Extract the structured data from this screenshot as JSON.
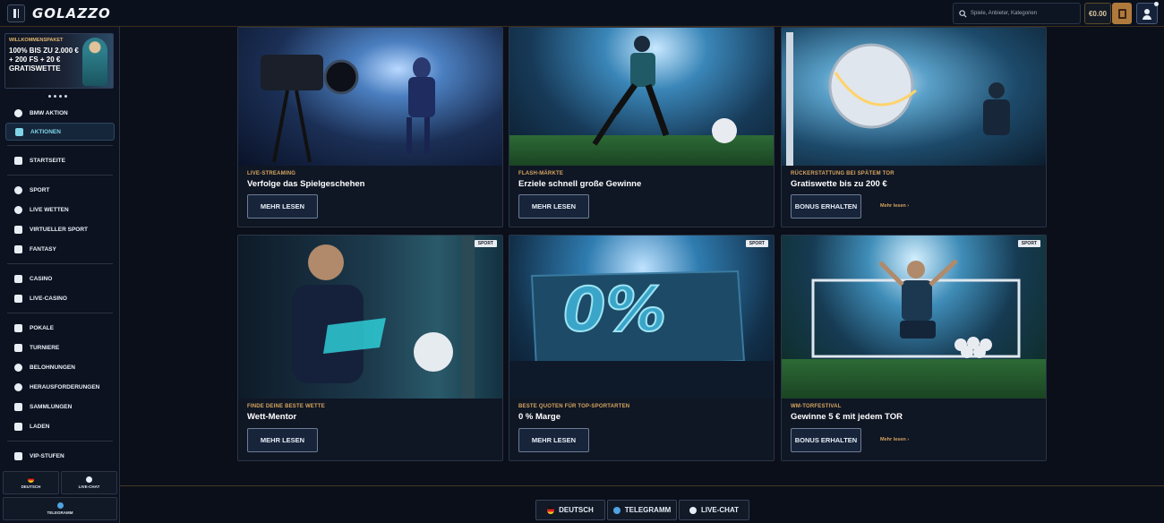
{
  "app": {
    "logo": "GOLAZZO"
  },
  "header": {
    "search_placeholder": "Spiele, Anbieter, Kategorien",
    "balance": "€0.00"
  },
  "sidebar": {
    "promo": {
      "kicker": "WILLKOMMENSPAKET",
      "text": "100% BIS ZU 2.000 € + 200 FS + 20 € GRATISWETTE"
    },
    "groups": [
      [
        {
          "label": "BMW AKTION",
          "icon": "soccer-ball-icon"
        },
        {
          "label": "AKTIONEN",
          "icon": "gift-icon",
          "active": true
        }
      ],
      [
        {
          "label": "STARTSEITE",
          "icon": "gamepad-icon"
        }
      ],
      [
        {
          "label": "SPORT",
          "icon": "soccer-ball-icon"
        },
        {
          "label": "LIVE WETTEN",
          "icon": "live-icon"
        },
        {
          "label": "VIRTUELLER SPORT",
          "icon": "virtual-icon"
        },
        {
          "label": "FANTASY",
          "icon": "shirt-icon"
        }
      ],
      [
        {
          "label": "CASINO",
          "icon": "cards-icon"
        },
        {
          "label": "LIVE-CASINO",
          "icon": "live-casino-icon"
        }
      ],
      [
        {
          "label": "POKALE",
          "icon": "trophy-icon"
        },
        {
          "label": "TURNIERE",
          "icon": "podium-icon"
        },
        {
          "label": "BELOHNUNGEN",
          "icon": "reward-icon"
        },
        {
          "label": "HERAUSFORDERUNGEN",
          "icon": "target-icon"
        },
        {
          "label": "SAMMLUNGEN",
          "icon": "collection-icon"
        },
        {
          "label": "LADEN",
          "icon": "shop-icon"
        }
      ],
      [
        {
          "label": "VIP-STUFEN",
          "icon": "vip-icon"
        }
      ]
    ],
    "buttons": {
      "language": "DEUTSCH",
      "chat": "LIVE-CHAT",
      "telegram": "TELEGRAMM"
    }
  },
  "cards": [
    {
      "kicker": "LIVE-STREAMING",
      "title": "Verfolge das Spielgeschehen",
      "button": "MEHR LESEN"
    },
    {
      "kicker": "FLASH-MÄRKTE",
      "title": "Erziele schnell große Gewinne",
      "button": "MEHR LESEN"
    },
    {
      "kicker": "RÜCKERSTATTUNG BEI SPÄTEM TOR",
      "title": "Gratiswette bis zu 200 €",
      "button": "BONUS ERHALTEN",
      "more": "Mehr lesen ›"
    },
    {
      "kicker": "FINDE DEINE BESTE WETTE",
      "title": "Wett-Mentor",
      "button": "MEHR LESEN",
      "badge": "SPORT"
    },
    {
      "kicker": "BESTE QUOTEN FÜR TOP-SPORTARTEN",
      "title": "0 % Marge",
      "button": "MEHR LESEN",
      "badge": "SPORT",
      "image_text": "0%"
    },
    {
      "kicker": "WM-TORFESTIVAL",
      "title": "Gewinne 5 € mit jedem TOR",
      "button": "BONUS ERHALTEN",
      "more": "Mehr lesen ›",
      "badge": "SPORT"
    }
  ],
  "footer": {
    "language": "DEUTSCH",
    "telegram": "TELEGRAMM",
    "chat": "LIVE-CHAT"
  }
}
